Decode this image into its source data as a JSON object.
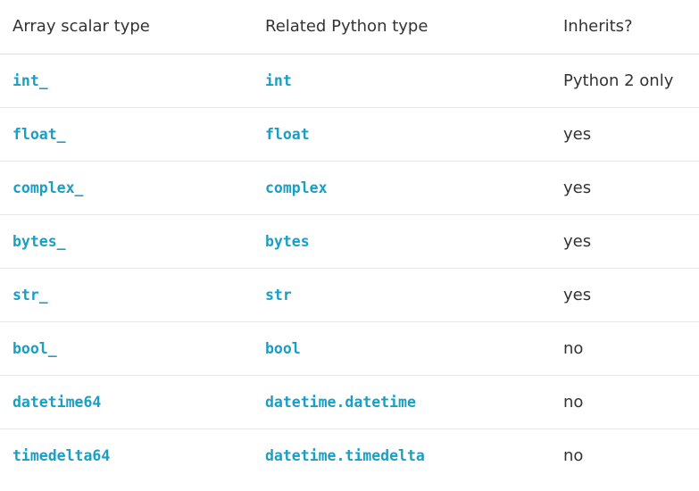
{
  "table": {
    "headers": [
      "Array scalar type",
      "Related Python type",
      "Inherits?"
    ],
    "rows": [
      {
        "array_scalar": "int_",
        "python_type": "int",
        "inherits": "Python 2 only"
      },
      {
        "array_scalar": "float_",
        "python_type": "float",
        "inherits": "yes"
      },
      {
        "array_scalar": "complex_",
        "python_type": "complex",
        "inherits": "yes"
      },
      {
        "array_scalar": "bytes_",
        "python_type": "bytes",
        "inherits": "yes"
      },
      {
        "array_scalar": "str_",
        "python_type": "str",
        "inherits": "yes"
      },
      {
        "array_scalar": "bool_",
        "python_type": "bool",
        "inherits": "no"
      },
      {
        "array_scalar": "datetime64",
        "python_type": "datetime.datetime",
        "inherits": "no"
      },
      {
        "array_scalar": "timedelta64",
        "python_type": "datetime.timedelta",
        "inherits": "no"
      }
    ]
  },
  "colors": {
    "link": "#1a9fc4",
    "text": "#333333",
    "rule": "#e8e8e8"
  }
}
